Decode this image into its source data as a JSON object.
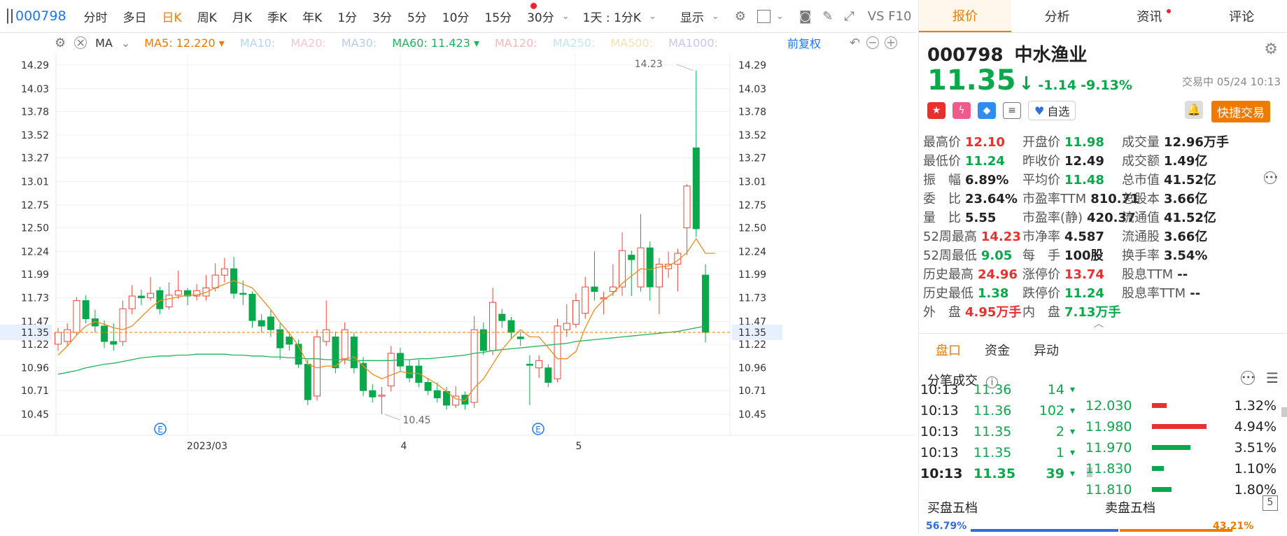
{
  "toolbar": {
    "code": "000798",
    "periods": [
      "分时",
      "多日",
      "日K",
      "周K",
      "月K",
      "季K",
      "年K",
      "1分",
      "3分",
      "5分",
      "10分",
      "15分",
      "30分"
    ],
    "active_period": "日K",
    "range_select": "1天 : 1分K",
    "display_label": "显示",
    "extra": "VS F10"
  },
  "ma_bar": {
    "ma_label": "MA",
    "items": [
      {
        "label": "MA5: 12.220",
        "color": "#f07a00",
        "arrow": true
      },
      {
        "label": "MA10:",
        "color": "#b5d6f2"
      },
      {
        "label": "MA20:",
        "color": "#f6c4d6"
      },
      {
        "label": "MA30:",
        "color": "#b8cde8"
      },
      {
        "label": "MA60: 11.423",
        "color": "#21b35c",
        "arrow": true
      },
      {
        "label": "MA120:",
        "color": "#f7b9b9"
      },
      {
        "label": "MA250:",
        "color": "#bfe8ec"
      },
      {
        "label": "MA500:",
        "color": "#f7e0b0"
      },
      {
        "label": "MA1000:",
        "color": "#c6c6f0"
      }
    ],
    "restore_label": "前复权"
  },
  "chart_data": {
    "type": "candlestick",
    "y_ticks": [
      "14.29",
      "14.03",
      "13.78",
      "13.52",
      "13.27",
      "13.01",
      "12.75",
      "12.50",
      "12.24",
      "11.99",
      "11.73",
      "11.47",
      "11.22",
      "10.96",
      "10.71",
      "10.45"
    ],
    "y_range": [
      10.3,
      14.4
    ],
    "x_labels": [
      "2023/03",
      "4",
      "5"
    ],
    "current_price_label": "11.35",
    "high_annotation": "14.23",
    "low_annotation": "10.45",
    "event_marker": "E",
    "candles": [
      {
        "o": 11.22,
        "c": 11.35,
        "h": 11.4,
        "l": 11.15
      },
      {
        "o": 11.25,
        "c": 11.38,
        "h": 11.45,
        "l": 11.2
      },
      {
        "o": 11.35,
        "c": 11.7,
        "h": 11.74,
        "l": 11.32
      },
      {
        "o": 11.7,
        "c": 11.5,
        "h": 11.76,
        "l": 11.45
      },
      {
        "o": 11.5,
        "c": 11.42,
        "h": 11.6,
        "l": 11.35
      },
      {
        "o": 11.42,
        "c": 11.25,
        "h": 11.48,
        "l": 11.18
      },
      {
        "o": 11.25,
        "c": 11.22,
        "h": 11.45,
        "l": 11.15
      },
      {
        "o": 11.25,
        "c": 11.61,
        "h": 11.7,
        "l": 11.2
      },
      {
        "o": 11.61,
        "c": 11.75,
        "h": 11.87,
        "l": 11.55
      },
      {
        "o": 11.75,
        "c": 11.73,
        "h": 11.82,
        "l": 11.65
      },
      {
        "o": 11.73,
        "c": 11.78,
        "h": 11.96,
        "l": 11.7
      },
      {
        "o": 11.81,
        "c": 11.61,
        "h": 11.85,
        "l": 11.55
      },
      {
        "o": 11.63,
        "c": 11.76,
        "h": 11.9,
        "l": 11.6
      },
      {
        "o": 11.76,
        "c": 11.81,
        "h": 12.03,
        "l": 11.72
      },
      {
        "o": 11.81,
        "c": 11.75,
        "h": 11.84,
        "l": 11.65
      },
      {
        "o": 11.75,
        "c": 11.81,
        "h": 11.88,
        "l": 11.7
      },
      {
        "o": 11.75,
        "c": 11.84,
        "h": 11.98,
        "l": 11.7
      },
      {
        "o": 11.84,
        "c": 11.98,
        "h": 12.11,
        "l": 11.8
      },
      {
        "o": 11.98,
        "c": 12.05,
        "h": 12.17,
        "l": 11.9
      },
      {
        "o": 12.05,
        "c": 11.78,
        "h": 12.18,
        "l": 11.72
      },
      {
        "o": 11.78,
        "c": 11.77,
        "h": 11.92,
        "l": 11.65
      },
      {
        "o": 11.77,
        "c": 11.48,
        "h": 11.8,
        "l": 11.4
      },
      {
        "o": 11.48,
        "c": 11.42,
        "h": 11.55,
        "l": 11.35
      },
      {
        "o": 11.52,
        "c": 11.38,
        "h": 11.6,
        "l": 11.3
      },
      {
        "o": 11.38,
        "c": 11.18,
        "h": 11.45,
        "l": 11.05
      },
      {
        "o": 11.3,
        "c": 11.22,
        "h": 11.36,
        "l": 11.15
      },
      {
        "o": 11.22,
        "c": 11.0,
        "h": 11.27,
        "l": 10.96
      },
      {
        "o": 11.0,
        "c": 10.61,
        "h": 11.05,
        "l": 10.55
      },
      {
        "o": 10.65,
        "c": 11.3,
        "h": 11.38,
        "l": 10.6
      },
      {
        "o": 11.25,
        "c": 11.38,
        "h": 11.7,
        "l": 11.2
      },
      {
        "o": 11.3,
        "c": 10.96,
        "h": 11.36,
        "l": 10.9
      },
      {
        "o": 11.06,
        "c": 11.38,
        "h": 11.46,
        "l": 11.0
      },
      {
        "o": 11.3,
        "c": 10.96,
        "h": 11.35,
        "l": 10.9
      },
      {
        "o": 11.01,
        "c": 10.71,
        "h": 11.08,
        "l": 10.65
      },
      {
        "o": 10.71,
        "c": 10.64,
        "h": 10.78,
        "l": 10.58
      },
      {
        "o": 10.65,
        "c": 10.66,
        "h": 10.75,
        "l": 10.45
      },
      {
        "o": 10.76,
        "c": 11.12,
        "h": 11.2,
        "l": 10.7
      },
      {
        "o": 11.12,
        "c": 10.98,
        "h": 11.18,
        "l": 10.92
      },
      {
        "o": 10.98,
        "c": 10.85,
        "h": 11.05,
        "l": 10.8
      },
      {
        "o": 10.98,
        "c": 10.8,
        "h": 11.05,
        "l": 10.75
      },
      {
        "o": 10.8,
        "c": 10.71,
        "h": 10.85,
        "l": 10.66
      },
      {
        "o": 10.71,
        "c": 10.63,
        "h": 10.8,
        "l": 10.58
      },
      {
        "o": 10.7,
        "c": 10.55,
        "h": 10.75,
        "l": 10.5
      },
      {
        "o": 10.55,
        "c": 10.65,
        "h": 10.76,
        "l": 10.52
      },
      {
        "o": 10.66,
        "c": 10.56,
        "h": 10.7,
        "l": 10.5
      },
      {
        "o": 10.58,
        "c": 11.38,
        "h": 11.53,
        "l": 10.52
      },
      {
        "o": 11.38,
        "c": 11.15,
        "h": 11.46,
        "l": 11.1
      },
      {
        "o": 11.15,
        "c": 11.68,
        "h": 11.84,
        "l": 11.1
      },
      {
        "o": 11.55,
        "c": 11.48,
        "h": 11.61,
        "l": 11.4
      },
      {
        "o": 11.48,
        "c": 11.35,
        "h": 11.52,
        "l": 11.28
      },
      {
        "o": 11.3,
        "c": 11.28,
        "h": 11.36,
        "l": 11.2
      },
      {
        "o": 11.0,
        "c": 10.99,
        "h": 11.1,
        "l": 10.55
      },
      {
        "o": 10.96,
        "c": 11.04,
        "h": 11.1,
        "l": 10.85
      },
      {
        "o": 10.96,
        "c": 10.8,
        "h": 11.0,
        "l": 10.75
      },
      {
        "o": 10.84,
        "c": 11.42,
        "h": 11.5,
        "l": 10.8
      },
      {
        "o": 11.38,
        "c": 11.45,
        "h": 11.66,
        "l": 11.3
      },
      {
        "o": 11.44,
        "c": 11.7,
        "h": 11.78,
        "l": 11.4
      },
      {
        "o": 11.56,
        "c": 11.85,
        "h": 11.96,
        "l": 11.5
      },
      {
        "o": 11.85,
        "c": 11.8,
        "h": 12.24,
        "l": 11.7
      },
      {
        "o": 11.73,
        "c": 11.73,
        "h": 11.8,
        "l": 11.55
      },
      {
        "o": 11.8,
        "c": 11.85,
        "h": 12.1,
        "l": 11.75
      },
      {
        "o": 11.85,
        "c": 12.25,
        "h": 12.45,
        "l": 11.75
      },
      {
        "o": 12.2,
        "c": 12.15,
        "h": 12.25,
        "l": 11.75
      },
      {
        "o": 11.85,
        "c": 12.28,
        "h": 12.65,
        "l": 11.8
      },
      {
        "o": 12.28,
        "c": 11.85,
        "h": 12.35,
        "l": 11.7
      },
      {
        "o": 11.85,
        "c": 12.1,
        "h": 12.17,
        "l": 11.55
      },
      {
        "o": 12.05,
        "c": 12.1,
        "h": 12.24,
        "l": 11.95
      },
      {
        "o": 12.1,
        "c": 12.22,
        "h": 12.27,
        "l": 11.8
      },
      {
        "o": 12.5,
        "c": 12.96,
        "h": 12.98,
        "l": 12.2
      },
      {
        "o": 13.38,
        "c": 12.49,
        "h": 14.23,
        "l": 12.4
      },
      {
        "o": 11.98,
        "c": 11.35,
        "h": 12.1,
        "l": 11.24
      }
    ],
    "ma5": [
      11.1,
      11.2,
      11.32,
      11.42,
      11.47,
      11.44,
      11.4,
      11.38,
      11.42,
      11.52,
      11.62,
      11.7,
      11.72,
      11.74,
      11.76,
      11.76,
      11.79,
      11.84,
      11.88,
      11.92,
      11.88,
      11.84,
      11.72,
      11.6,
      11.46,
      11.34,
      11.2,
      11.0,
      10.96,
      10.98,
      10.98,
      11.06,
      11.08,
      10.98,
      10.89,
      10.84,
      10.88,
      10.92,
      10.9,
      10.9,
      10.84,
      10.78,
      10.7,
      10.62,
      10.6,
      10.74,
      10.84,
      11.0,
      11.16,
      11.28,
      11.38,
      11.3,
      11.3,
      11.18,
      11.06,
      11.06,
      11.14,
      11.4,
      11.6,
      11.71,
      11.78,
      11.89,
      11.97,
      12.05,
      12.04,
      12.07,
      12.08,
      12.14,
      12.23,
      12.38,
      12.22
    ],
    "ma60": [
      10.89,
      10.91,
      10.93,
      10.96,
      10.98,
      11.0,
      11.01,
      11.03,
      11.05,
      11.07,
      11.08,
      11.09,
      11.09,
      11.1,
      11.1,
      11.11,
      11.11,
      11.11,
      11.11,
      11.1,
      11.1,
      11.09,
      11.09,
      11.08,
      11.08,
      11.07,
      11.07,
      11.06,
      11.06,
      11.05,
      11.05,
      11.05,
      11.04,
      11.04,
      11.04,
      11.04,
      11.04,
      11.05,
      11.05,
      11.06,
      11.06,
      11.07,
      11.08,
      11.09,
      11.1,
      11.12,
      11.13,
      11.15,
      11.16,
      11.17,
      11.18,
      11.19,
      11.2,
      11.21,
      11.22,
      11.23,
      11.25,
      11.26,
      11.27,
      11.28,
      11.29,
      11.3,
      11.31,
      11.32,
      11.33,
      11.34,
      11.35,
      11.36,
      11.38,
      11.4,
      11.42
    ]
  },
  "panel": {
    "tabs": [
      "报价",
      "分析",
      "资讯",
      "评论"
    ],
    "active_tab": "报价",
    "code": "000798",
    "name": "中水渔业",
    "price": "11.35",
    "change": "-1.14",
    "change_pct": "-9.13%",
    "status": "交易中 05/24 10:13",
    "fav_label": "自选",
    "quick_trade": "快捷交易",
    "col1": [
      {
        "label": "最高价",
        "value": "12.10",
        "color": "red"
      },
      {
        "label": "最低价",
        "value": "11.24",
        "color": "green"
      },
      {
        "label": "振　幅",
        "value": "6.89%",
        "color": "dark"
      },
      {
        "label": "委　比",
        "value": "23.64%",
        "color": "dark"
      },
      {
        "label": "量　比",
        "value": "5.55",
        "color": "dark"
      },
      {
        "label": "52周最高",
        "value": "14.23",
        "color": "red"
      },
      {
        "label": "52周最低",
        "value": "9.05",
        "color": "green"
      },
      {
        "label": "历史最高",
        "value": "24.96",
        "color": "red"
      },
      {
        "label": "历史最低",
        "value": "1.38",
        "color": "green"
      },
      {
        "label": "外　盘",
        "value": "4.95万手",
        "color": "red"
      }
    ],
    "col2": [
      {
        "label": "开盘价",
        "value": "11.98",
        "color": "green"
      },
      {
        "label": "昨收价",
        "value": "12.49",
        "color": "dark"
      },
      {
        "label": "平均价",
        "value": "11.48",
        "color": "green"
      },
      {
        "label": "市盈率TTM",
        "value": "810.71",
        "color": "dark"
      },
      {
        "label": "市盈率(静)",
        "value": "420.37",
        "color": "dark"
      },
      {
        "label": "市净率",
        "value": "4.587",
        "color": "dark"
      },
      {
        "label": "每　手",
        "value": "100股",
        "color": "dark"
      },
      {
        "label": "涨停价",
        "value": "13.74",
        "color": "red"
      },
      {
        "label": "跌停价",
        "value": "11.24",
        "color": "green"
      },
      {
        "label": "内　盘",
        "value": "7.13万手",
        "color": "green"
      }
    ],
    "col3": [
      {
        "label": "成交量",
        "value": "12.96万手",
        "color": "dark"
      },
      {
        "label": "成交额",
        "value": "1.49亿",
        "color": "dark"
      },
      {
        "label": "总市值",
        "value": "41.52亿",
        "color": "dark"
      },
      {
        "label": "总股本",
        "value": "3.66亿",
        "color": "dark"
      },
      {
        "label": "流通值",
        "value": "41.52亿",
        "color": "dark"
      },
      {
        "label": "流通股",
        "value": "3.66亿",
        "color": "dark"
      },
      {
        "label": "换手率",
        "value": "3.54%",
        "color": "dark"
      },
      {
        "label": "股息TTM",
        "value": "--",
        "color": "dark"
      },
      {
        "label": "股息率TTM",
        "value": "--",
        "color": "dark"
      }
    ],
    "subtabs": [
      "盘口",
      "资金",
      "异动"
    ],
    "active_subtab": "盘口",
    "ticks_title": "分笔成交",
    "trades": [
      {
        "time": "10:13",
        "price": "11.36",
        "vol": "14"
      },
      {
        "time": "10:13",
        "price": "11.36",
        "vol": "102"
      },
      {
        "time": "10:13",
        "price": "11.35",
        "vol": "2"
      },
      {
        "time": "10:13",
        "price": "11.35",
        "vol": "1"
      },
      {
        "time": "10:13",
        "price": "11.35",
        "vol": "39"
      }
    ],
    "dist": [
      {
        "price": "12.030",
        "pct": "1.32%",
        "color": "red",
        "frac": 0.27
      },
      {
        "price": "11.980",
        "pct": "4.94%",
        "color": "red",
        "frac": 1.0
      },
      {
        "price": "11.970",
        "pct": "3.51%",
        "color": "green",
        "frac": 0.71
      },
      {
        "price": "11.830",
        "pct": "1.10%",
        "color": "green",
        "frac": 0.22
      },
      {
        "price": "11.810",
        "pct": "1.80%",
        "color": "green",
        "frac": 0.36
      }
    ],
    "buy_title": "买盘五档",
    "sell_title": "卖盘五档",
    "buy_pct": "56.79%",
    "sell_pct": "43.21%",
    "page_num": "5"
  }
}
